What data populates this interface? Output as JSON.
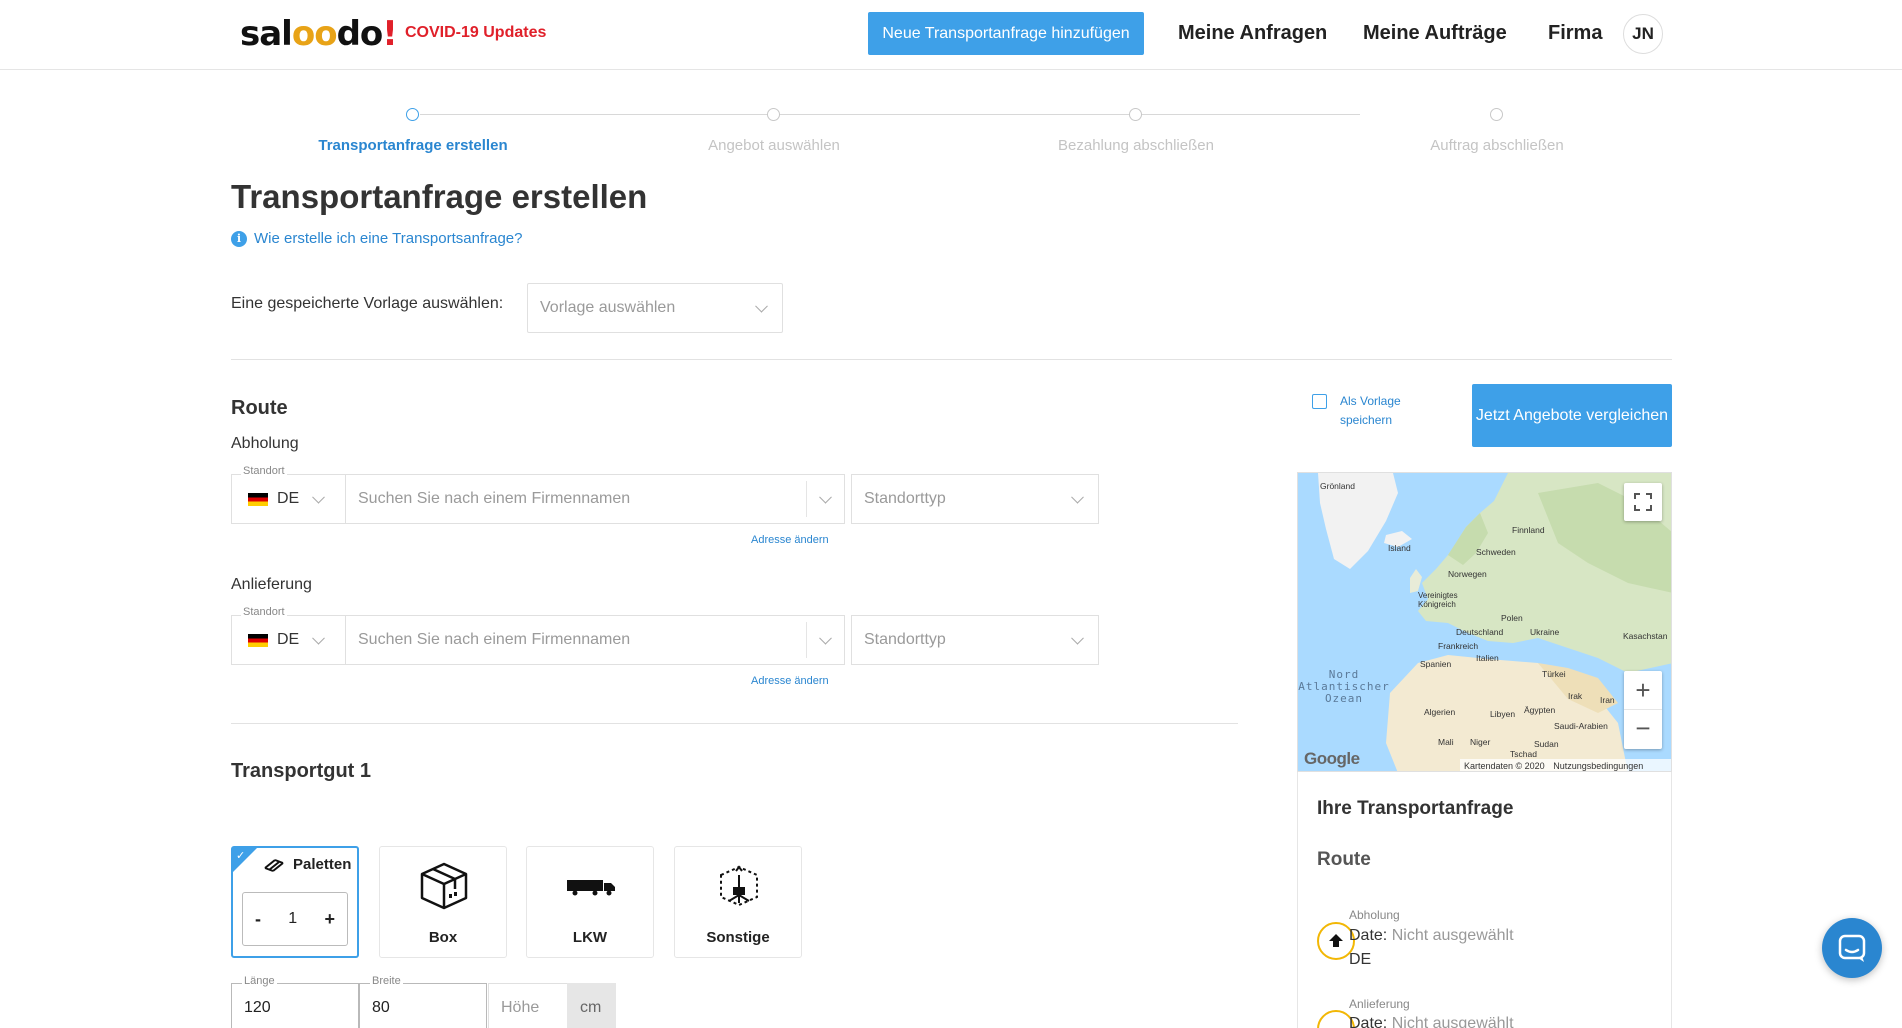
{
  "header": {
    "logo": "saloodo!",
    "covid_link": "COVID-19 Updates",
    "new_request_button": "Neue Transportanfrage hinzufügen",
    "nav": [
      "Meine Anfragen",
      "Meine Aufträge",
      "Firma"
    ],
    "avatar_initials": "JN",
    "accent_color": "#3ea0e8"
  },
  "stepper": {
    "steps": [
      {
        "label": "Transportanfrage erstellen",
        "active": true
      },
      {
        "label": "Angebot auswählen",
        "active": false
      },
      {
        "label": "Bezahlung abschließen",
        "active": false
      },
      {
        "label": "Auftrag abschließen",
        "active": false
      }
    ]
  },
  "page": {
    "title": "Transportanfrage erstellen",
    "help_link": "Wie erstelle ich eine Transportsanfrage?",
    "template_label": "Eine gespeicherte Vorlage auswählen:",
    "template_placeholder": "Vorlage auswählen"
  },
  "route": {
    "title": "Route",
    "pickup": {
      "label": "Abholung",
      "field_label": "Standort",
      "country": "DE",
      "company_placeholder": "Suchen Sie nach einem Firmennamen",
      "location_type_placeholder": "Standorttyp",
      "change_address": "Adresse ändern"
    },
    "delivery": {
      "label": "Anlieferung",
      "field_label": "Standort",
      "country": "DE",
      "company_placeholder": "Suchen Sie nach einem Firmennamen",
      "location_type_placeholder": "Standorttyp",
      "change_address": "Adresse ändern"
    }
  },
  "goods": {
    "title": "Transportgut 1",
    "types": [
      {
        "label": "Paletten",
        "icon": "pallet-icon",
        "selected": true
      },
      {
        "label": "Box",
        "icon": "box-icon",
        "selected": false
      },
      {
        "label": "LKW",
        "icon": "truck-icon",
        "selected": false
      },
      {
        "label": "Sonstige",
        "icon": "package-icon",
        "selected": false
      }
    ],
    "quantity": "1",
    "minus": "-",
    "plus": "+",
    "dimensions": {
      "length_label": "Länge",
      "length_value": "120",
      "width_label": "Breite",
      "width_value": "80",
      "height_placeholder": "Höhe",
      "unit": "cm"
    }
  },
  "sidebar": {
    "save_template_label": "Als Vorlage speichern",
    "compare_button": "Jetzt Angebote vergleichen",
    "map": {
      "labels": [
        "Grönland",
        "Island",
        "Finnland",
        "Schweden",
        "Norwegen",
        "Vereinigtes Königreich",
        "Polen",
        "Deutschland",
        "Ukraine",
        "Kasachstan",
        "Frankreich",
        "Italien",
        "Spanien",
        "Türkei",
        "Nord Atlantischer Ozean",
        "Irak",
        "Iran",
        "Algerien",
        "Libyen",
        "Ägypten",
        "Saudi-Arabien",
        "Mali",
        "Niger",
        "Tschad",
        "Sudan"
      ],
      "google": "Google",
      "attribution": "Kartendaten © 2020",
      "terms": "Nutzungsbedingungen"
    },
    "summary": {
      "title": "Ihre Transportanfrage",
      "route_title": "Route",
      "pickup_label": "Abholung",
      "pickup_date_key": "Date:",
      "pickup_date_value": "Nicht ausgewählt",
      "pickup_country": "DE",
      "delivery_label": "Anlieferung",
      "delivery_date_key": "Date:",
      "delivery_date_value": "Nicht ausgewählt"
    }
  }
}
